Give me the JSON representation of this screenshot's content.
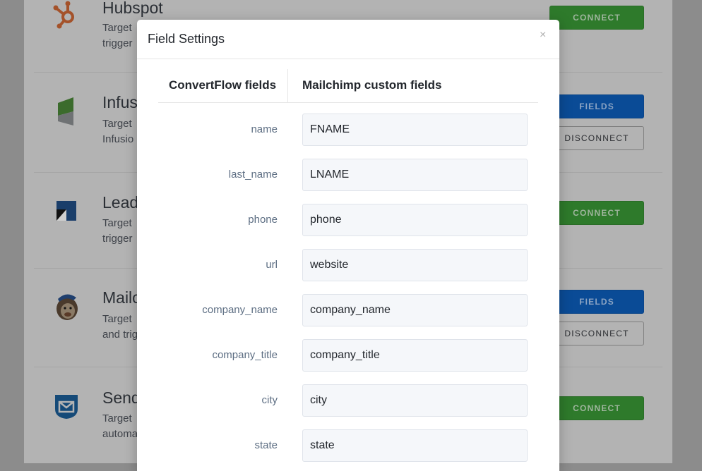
{
  "integrations": [
    {
      "name": "Hubspot",
      "desc_lines": [
        "Target",
        "trigger"
      ],
      "buttons": [
        "CONNECT"
      ]
    },
    {
      "name": "Infusionsoft",
      "desc_lines": [
        "Target",
        "Infusio"
      ],
      "buttons": [
        "FIELDS",
        "DISCONNECT"
      ]
    },
    {
      "name": "Leadpages",
      "desc_lines": [
        "Target",
        "trigger"
      ],
      "buttons": [
        "CONNECT"
      ]
    },
    {
      "name": "Mailchimp",
      "desc_lines": [
        "Target",
        "and trig"
      ],
      "buttons": [
        "FIELDS",
        "DISCONNECT"
      ]
    },
    {
      "name": "Sendlane",
      "desc_lines": [
        "Target",
        "automa"
      ],
      "buttons": [
        "CONNECT"
      ]
    }
  ],
  "modal": {
    "title": "Field Settings",
    "close": "×",
    "col_left": "ConvertFlow fields",
    "col_right": "Mailchimp custom fields",
    "fields": [
      {
        "label": "name",
        "value": "FNAME"
      },
      {
        "label": "last_name",
        "value": "LNAME"
      },
      {
        "label": "phone",
        "value": "phone"
      },
      {
        "label": "url",
        "value": "website"
      },
      {
        "label": "company_name",
        "value": "company_name"
      },
      {
        "label": "company_title",
        "value": "company_title"
      },
      {
        "label": "city",
        "value": "city"
      },
      {
        "label": "state",
        "value": "state"
      }
    ]
  },
  "colors": {
    "connect_green": "#2e7a2b",
    "fields_blue": "#0a4b96",
    "hubspot_orange": "#c0531f"
  }
}
